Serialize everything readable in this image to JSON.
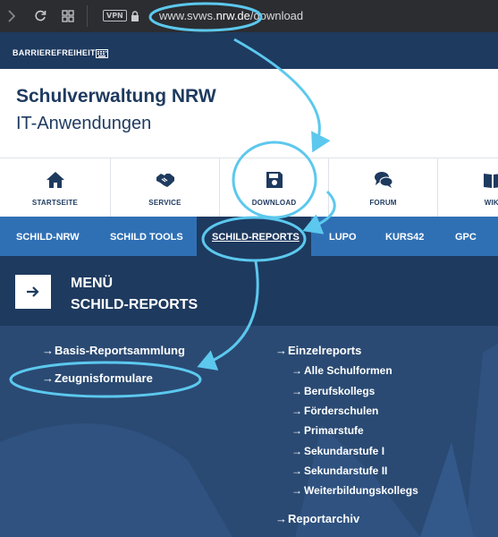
{
  "browser": {
    "vpn_label": "VPN",
    "url_prefix": "www.svws.",
    "url_domain": "nrw.de",
    "url_suffix": "/download"
  },
  "site": {
    "accessibility_label": "BARRIEREFREIHEIT",
    "title": "Schulverwaltung NRW",
    "subtitle": "IT-Anwendungen"
  },
  "icon_nav": [
    {
      "label": "STARTSEITE",
      "icon": "home-icon"
    },
    {
      "label": "SERVICE",
      "icon": "handshake-icon"
    },
    {
      "label": "DOWNLOAD",
      "icon": "save-icon"
    },
    {
      "label": "FORUM",
      "icon": "chat-icon"
    },
    {
      "label": "WIKI",
      "icon": "book-icon"
    }
  ],
  "main_nav": [
    "SCHILD-NRW",
    "SCHILD TOOLS",
    "SCHILD-REPORTS",
    "LUPO",
    "KURS42",
    "GPC"
  ],
  "menu": {
    "title_line1": "MENÜ",
    "title_line2": "SCHILD-REPORTS"
  },
  "left_links": [
    "Basis-Reportsammlung",
    "Zeugnisformulare"
  ],
  "right_links": {
    "einzelreports": "Einzelreports",
    "sub": [
      "Alle Schulformen",
      "Berufskollegs",
      "Förderschulen",
      "Primarstufe",
      "Sekundarstufe I",
      "Sekundarstufe II",
      "Weiterbildungskollegs"
    ],
    "reportarchiv": "Reportarchiv"
  },
  "colors": {
    "dark_navy": "#1e3a5f",
    "nav_blue": "#2f70b5",
    "annotation_cyan": "#5cc8ee"
  }
}
